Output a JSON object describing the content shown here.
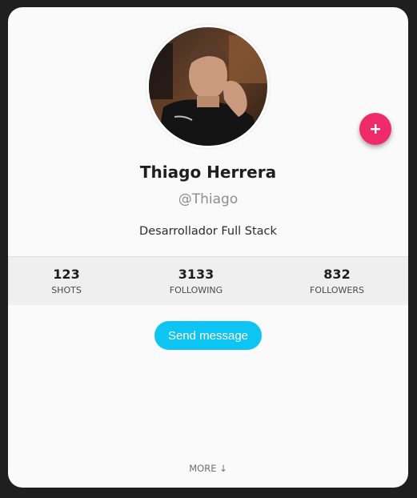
{
  "profile": {
    "name": "Thiago Herrera",
    "handle": "@Thiago",
    "bio": "Desarrollador Full Stack",
    "avatar_icon": "profile-photo"
  },
  "fab": {
    "icon": "plus-icon",
    "color": "#ef2a6b"
  },
  "stats": [
    {
      "value": "123",
      "label": "SHOTS"
    },
    {
      "value": "3133",
      "label": "FOLLOWING"
    },
    {
      "value": "832",
      "label": "FOLLOWERS"
    }
  ],
  "actions": {
    "send_message_label": "Send message",
    "send_message_color": "#0dc4f2",
    "more_label": "MORE ↓"
  }
}
